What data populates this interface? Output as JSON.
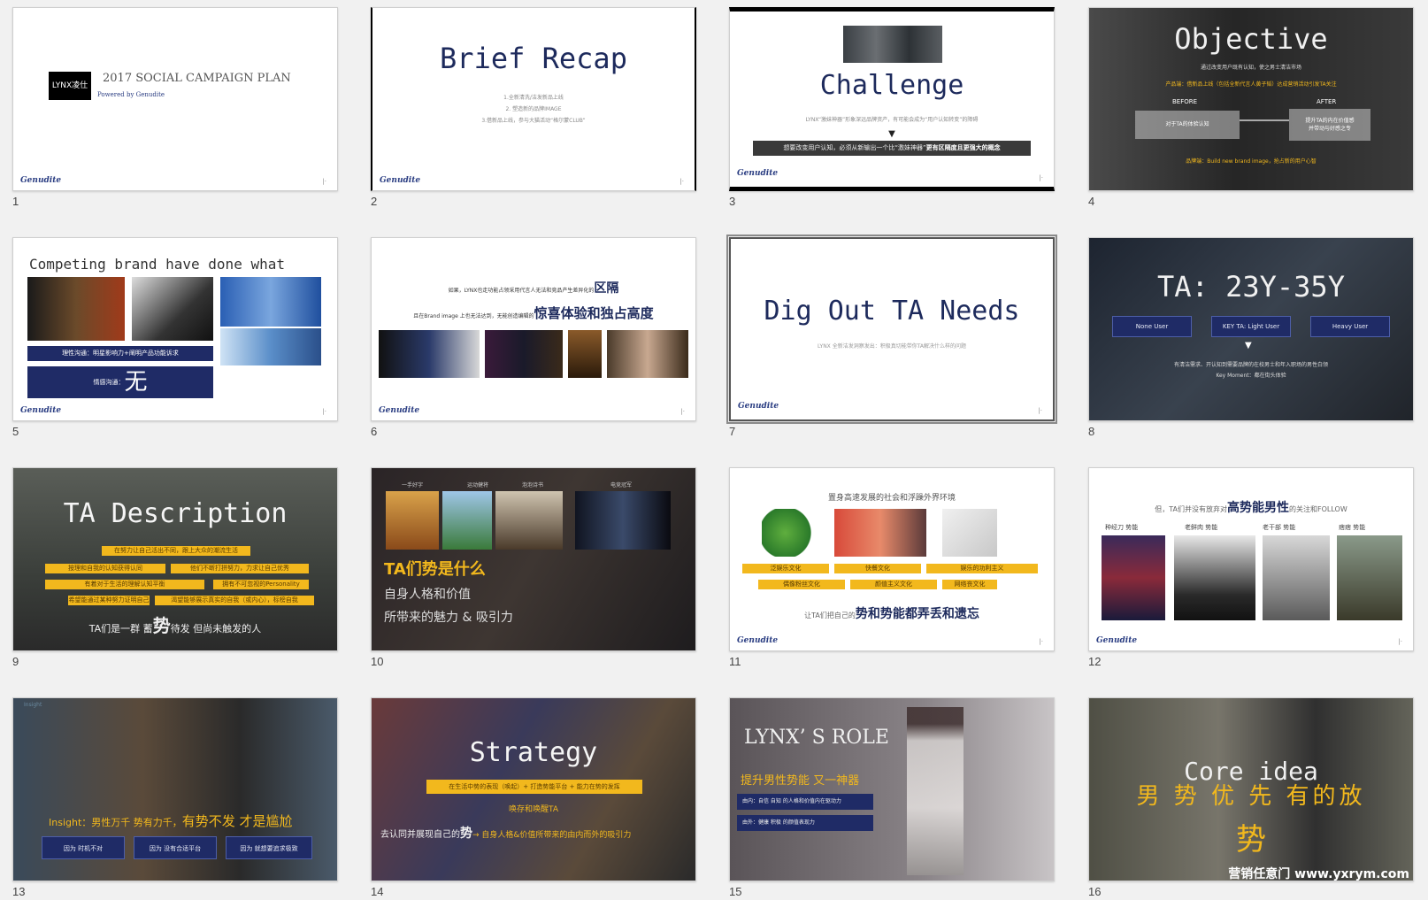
{
  "slides": [
    {
      "num": "1",
      "logo": "LYNX凌仕",
      "title": "2017 SOCIAL CAMPAIGN PLAN",
      "sub": "Powered by Genudite"
    },
    {
      "num": "2",
      "title": "Brief Recap",
      "lines": [
        "1.全新清洗/洁发新品上线",
        "2. 塑造新的品牌IMAGE",
        "3.借新品上线，参与大猫活动“格尔蒙CLUB”"
      ]
    },
    {
      "num": "3",
      "title": "Challenge",
      "line": "LYNX“激妹神器”形象深远品牌资产，有可能会成为“用户认知转变”的障碍",
      "bar_a": "想要改变用户认知，必须从新输出一个比“激妹神器”",
      "bar_b": "更有区隔度且更强大的概念"
    },
    {
      "num": "4",
      "title": "Objective",
      "line1": "通过改变用户既有认知，使之男士清洁市场",
      "line2": "产品端：借新品上线（包括全新代言人黄子韬）达成营销活动引发TA关注",
      "before": "BEFORE",
      "after": "AFTER",
      "before_box": "对于TA的体验认知",
      "after_box": "提升TA的内在价值感\n并带动与好感之专",
      "line3": "品牌端：Build new brand image，抢占新的用户心智"
    },
    {
      "num": "5",
      "title": "Competing brand have done what",
      "bar1": "理性沟通：明星影响力+阐明产品功能诉求",
      "bar2_label": "情感沟通：",
      "bar2_big": "无"
    },
    {
      "num": "6",
      "line1_pre": "如果，LYNX也走功能占领采用代言人无法和竞品产生差异化的",
      "line1_em": "区隔",
      "line2_pre": "且在Brand image 上也无法达到，无能创造编辑的",
      "line2_em": "惊喜体验和独占高度"
    },
    {
      "num": "7",
      "title": "Dig Out TA Needs",
      "line": "LYNX 全新洁发洞察发出：积极真切能带你TA解决什么样的问题"
    },
    {
      "num": "8",
      "title": "TA: 23Y-35Y",
      "btn1": "None User",
      "btn2": "KEY TA: Light User",
      "btn3": "Heavy User",
      "line1": "有清洁需求、开认知到需要品牌的在校男士和年入职场的男性白领",
      "line2": "Key Moment：都在街头体验"
    },
    {
      "num": "9",
      "title": "TA Description",
      "bars": [
        "在努力让自己活出不同，跟上大众的潮流生活",
        "按理和自我的认知获得认同",
        "他们不断打拼努力，力求让自己优秀",
        "有着对于生活的理解认知平衡",
        "拥有不可忽视的Personality",
        "希望能通过某种努力证明自己",
        "渴望能够展示真实的自我（或内心），标榜自我"
      ],
      "line_pre": "TA们是一群 蓄",
      "line_em": "势",
      "line_post": "待发 但尚未触发的人"
    },
    {
      "num": "10",
      "caps": [
        "一手好字",
        "运动健将",
        "泡泡诗书",
        "电竞冠军"
      ],
      "title": "TA们势是什么",
      "line1": "自身人格和价值",
      "line2": "所带来的魅力 & 吸引力"
    },
    {
      "num": "11",
      "top": "置身高速发展的社会和浮躁外界环境",
      "tags1": [
        "泛娱乐文化",
        "快餐文化",
        "娱乐的功利主义"
      ],
      "tags2": [
        "偶像粉丝文化",
        "颜值主义文化",
        "网络丧文化"
      ],
      "line_pre": "让TA们把自己的",
      "line_em": "势和势能都弄丢和遗忘"
    },
    {
      "num": "12",
      "line_pre": "但，TA们并没有放弃对",
      "line_em": "高势能男性",
      "line_post": "的关注和FOLLOW",
      "caps": [
        "种经刀 势能",
        "老鲜肉 势能",
        "老干部 势能",
        "痞痞 势能"
      ]
    },
    {
      "num": "13",
      "top": "Insight",
      "line_pre": "Insight：男性万千 势有力千，",
      "line_em": "有势不发 才是尴尬",
      "btns": [
        "因为 时机不对",
        "因为 没有合适平台",
        "因为 就想要追求极致"
      ]
    },
    {
      "num": "14",
      "title": "Strategy",
      "bar": "在生活中势的表现（唤起）+ 打造势能平台 + 能力在势的发挥",
      "line1": "唤存和唤醒TA",
      "line2_pre": "去认同并展现自己的",
      "line2_em": "势",
      "line2_post": "→ 自身人格&价值所带来的由内而外的吸引力"
    },
    {
      "num": "15",
      "title": "LYNX’ S  ROLE",
      "line": "提升男性势能 又一神器",
      "box1": "由内：自信 自知 的人格和价值内在驱动力",
      "box2": "由外：健康 积极 的颜值表现力"
    },
    {
      "num": "16",
      "title": "Core idea",
      "big1": "男 势 优 先 有的放",
      "big2": "势",
      "watermark": "营销任意门 www.yxrym.com"
    }
  ],
  "colors": {
    "navy": "#1d2a5c",
    "yellow": "#f2b81d",
    "gray": "#888888"
  },
  "brand": "Genudite"
}
